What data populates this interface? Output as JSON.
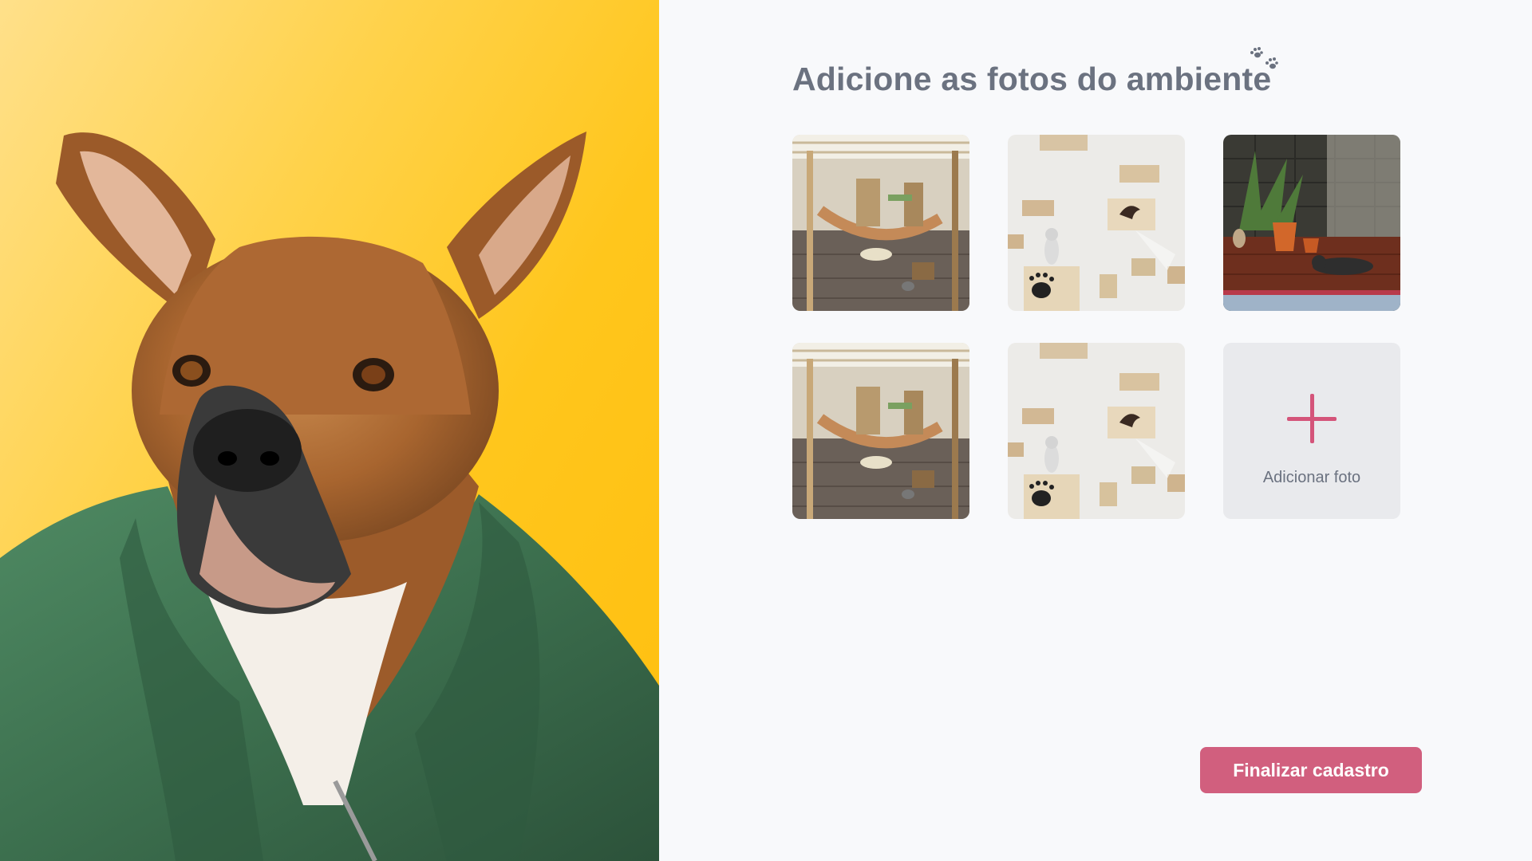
{
  "hero": {
    "image": "dog-in-green-jacket",
    "background": "#ffc61c"
  },
  "page": {
    "title": "Adicione as fotos do ambiente",
    "title_icon": "paw-prints-icon"
  },
  "photos": [
    {
      "name": "photo-tile-1",
      "scene": "cattery-wooden-bridge"
    },
    {
      "name": "photo-tile-2",
      "scene": "cat-wall-shelves"
    },
    {
      "name": "photo-tile-3",
      "scene": "cats-with-plants-room"
    },
    {
      "name": "photo-tile-4",
      "scene": "cattery-wooden-bridge"
    },
    {
      "name": "photo-tile-5",
      "scene": "cat-wall-shelves"
    }
  ],
  "add_photo": {
    "label": "Adicionar foto",
    "icon": "plus-icon",
    "icon_color": "#d4547a"
  },
  "finish": {
    "label": "Finalizar cadastro",
    "color": "#d15f7e"
  }
}
